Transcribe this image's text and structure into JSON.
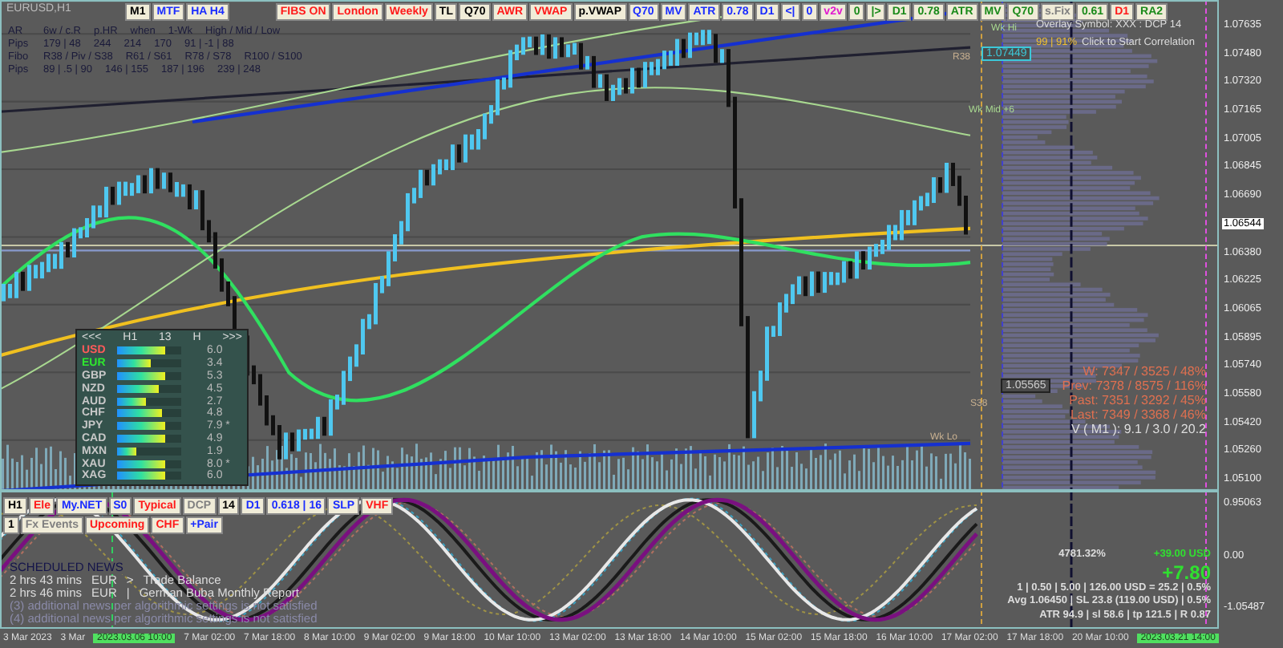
{
  "symbol": "EURUSD,H1",
  "toolbar": [
    {
      "label": "M1",
      "color": "#000000"
    },
    {
      "label": "MTF",
      "color": "#1a2cff"
    },
    {
      "label": "HA H4",
      "color": "#1a2cff"
    },
    {
      "label": "FIBS ON",
      "color": "#ff1a1a"
    },
    {
      "label": "London",
      "color": "#ff1a1a"
    },
    {
      "label": "Weekly",
      "color": "#ff1a1a"
    },
    {
      "label": "TL",
      "color": "#000000"
    },
    {
      "label": "Q70",
      "color": "#000000"
    },
    {
      "label": "AWR",
      "color": "#ff1a1a"
    },
    {
      "label": "VWAP",
      "color": "#ff1a1a"
    },
    {
      "label": "p.VWAP",
      "color": "#000000"
    },
    {
      "label": "Q70",
      "color": "#1a2cff"
    },
    {
      "label": "MV",
      "color": "#1a2cff"
    },
    {
      "label": "ATR",
      "color": "#1a2cff"
    },
    {
      "label": "0.78",
      "color": "#1a2cff"
    },
    {
      "label": "D1",
      "color": "#1a2cff"
    },
    {
      "label": "<|",
      "color": "#1a2cff"
    },
    {
      "label": "0",
      "color": "#1a2cff"
    },
    {
      "label": "v2v",
      "color": "#e01ad0"
    },
    {
      "label": "0",
      "color": "#1a8a1a"
    },
    {
      "label": "|>",
      "color": "#1a8a1a"
    },
    {
      "label": "D1",
      "color": "#1a8a1a"
    },
    {
      "label": "0.78",
      "color": "#1a8a1a"
    },
    {
      "label": "ATR",
      "color": "#1a8a1a"
    },
    {
      "label": "MV",
      "color": "#1a8a1a"
    },
    {
      "label": "Q70",
      "color": "#1a8a1a"
    },
    {
      "label": "s.Fix",
      "color": "#808080"
    },
    {
      "label": "0.61",
      "color": "#1a8a1a"
    },
    {
      "label": "D1",
      "color": "#ff1a1a"
    },
    {
      "label": "RA2",
      "color": "#1a8a1a"
    }
  ],
  "info_rows": [
    [
      "AR",
      "6w / c.R",
      "p.HR",
      "when",
      "1-Wk",
      "High / Mid / Low"
    ],
    [
      "Pips",
      "179 | 48",
      "244",
      "214",
      "170",
      "91 | -1 | 88"
    ],
    [
      "Fibo",
      "R38 / Piv / S38",
      "R61 / S61",
      "R78 / S78",
      "R100 / S100"
    ],
    [
      "Pips",
      "89 | .5 | 90",
      "146 | 155",
      "187 | 196",
      "239 | 248"
    ]
  ],
  "strength": {
    "header": [
      "<<<",
      "H1",
      "13",
      "H",
      ">>>"
    ],
    "rows": [
      {
        "currency": "USD",
        "value": "6.0",
        "level": 0.75,
        "color": "#ff5a5a"
      },
      {
        "currency": "EUR",
        "value": "3.4",
        "level": 0.52,
        "color": "#2ee82e"
      },
      {
        "currency": "GBP",
        "value": "5.3",
        "level": 0.75,
        "color": "#c8c8c8"
      },
      {
        "currency": "NZD",
        "value": "4.5",
        "level": 0.65,
        "color": "#c8c8c8"
      },
      {
        "currency": "AUD",
        "value": "2.7",
        "level": 0.45,
        "color": "#c8c8c8"
      },
      {
        "currency": "CHF",
        "value": "4.8",
        "level": 0.7,
        "color": "#c8c8c8"
      },
      {
        "currency": "JPY",
        "value": "7.9 *",
        "level": 0.75,
        "color": "#c8c8c8"
      },
      {
        "currency": "CAD",
        "value": "4.9",
        "level": 0.75,
        "color": "#c8c8c8"
      },
      {
        "currency": "MXN",
        "value": "1.9",
        "level": 0.3,
        "color": "#c8c8c8"
      },
      {
        "currency": "XAU",
        "value": "8.0 *",
        "level": 0.75,
        "color": "#c8c8c8"
      },
      {
        "currency": "XAG",
        "value": "6.0",
        "level": 0.75,
        "color": "#c8c8c8"
      }
    ]
  },
  "overlay": {
    "line1": "Overlay Symbol: XXX : DCP 14",
    "score": "99 | 91%",
    "action": "Click to Start Correlation"
  },
  "chart_labels": [
    {
      "text": "Wk Hi",
      "kind": "level"
    },
    {
      "text": "R38",
      "kind": "level"
    },
    {
      "text": "Wk Mid +6",
      "kind": "level"
    },
    {
      "text": "S38",
      "kind": "level"
    },
    {
      "text": "Wk Lo",
      "kind": "level"
    },
    {
      "text": "1.07449",
      "kind": "price"
    },
    {
      "text": "1.05565",
      "kind": "price"
    }
  ],
  "volume_stats": [
    "W: 7347 / 3525 / 48%",
    "Prev: 7378 / 8575 / 116%",
    "Past: 7351 / 3292 / 45%",
    "Last: 7349 / 3368 / 46%"
  ],
  "volume_m1": "V ( M1 ): 9.1 / 3.0 / 20.2",
  "price_axis": [
    {
      "text": "1.07635",
      "highlighted": false
    },
    {
      "text": "1.07480",
      "highlighted": false
    },
    {
      "text": "1.07320",
      "highlighted": false
    },
    {
      "text": "1.07165",
      "highlighted": false
    },
    {
      "text": "1.07005",
      "highlighted": false
    },
    {
      "text": "1.06845",
      "highlighted": false
    },
    {
      "text": "1.06690",
      "highlighted": false
    },
    {
      "text": "1.06544",
      "highlighted": true
    },
    {
      "text": "1.06380",
      "highlighted": false
    },
    {
      "text": "1.06225",
      "highlighted": false
    },
    {
      "text": "1.06065",
      "highlighted": false
    },
    {
      "text": "1.05895",
      "highlighted": false
    },
    {
      "text": "1.05740",
      "highlighted": false
    },
    {
      "text": "1.05580",
      "highlighted": false
    },
    {
      "text": "1.05420",
      "highlighted": false
    },
    {
      "text": "1.05260",
      "highlighted": false
    },
    {
      "text": "1.05100",
      "highlighted": false
    }
  ],
  "osc_toolbar": [
    [
      {
        "label": "H1",
        "color": "#000000"
      },
      {
        "label": "Ele",
        "color": "#ff1a1a"
      },
      {
        "label": "My.NET",
        "color": "#1a2cff"
      },
      {
        "label": "S0",
        "color": "#1a2cff"
      },
      {
        "label": "Typical",
        "color": "#ff1a1a"
      },
      {
        "label": "DCP",
        "color": "#808080"
      },
      {
        "label": "14",
        "color": "#000000"
      },
      {
        "label": "D1",
        "color": "#1a2cff"
      },
      {
        "label": "0.618 | 16",
        "color": "#1a2cff"
      },
      {
        "label": "SLP",
        "color": "#1a2cff"
      },
      {
        "label": "VHF",
        "color": "#ff1a1a"
      }
    ],
    [
      {
        "label": "1",
        "color": "#000000"
      },
      {
        "label": "Fx Events",
        "color": "#808080"
      },
      {
        "label": "Upcoming",
        "color": "#ff1a1a"
      },
      {
        "label": "CHF",
        "color": "#ff1a1a"
      },
      {
        "label": "+Pair",
        "color": "#1a2cff"
      }
    ]
  ],
  "news": {
    "title": "SCHEDULED NEWS",
    "items": [
      {
        "time": "2 hrs 43 mins",
        "currency": "EUR",
        "sep": ">",
        "event": "Trade Balance"
      },
      {
        "time": "2 hrs 46 mins",
        "currency": "EUR",
        "sep": "|",
        "event": "German Buba Monthly Report"
      }
    ],
    "notes": [
      "(3) additional news per algorithmic settings is not satisfied",
      "(4) additional news per algorithmic settings is not satisfied"
    ]
  },
  "trade": {
    "percent": "4781.32%",
    "profit": "+39.00 USD",
    "pips": "+7.80",
    "lines": [
      "1 | 0.50 | 5.00 | 126.00 USD = 25.2 | 0.5%",
      "Avg 1.06450 | SL 23.8 (119.00 USD) | 0.5%",
      "ATR 94.9 | sl 58.6 | tp 121.5 | R 0.87"
    ]
  },
  "osc_axis": [
    "0.95063",
    "0.00",
    "-1.05487"
  ],
  "time_axis": [
    {
      "text": "3 Mar 2023",
      "highlighted": false
    },
    {
      "text": "3 Mar",
      "highlighted": false
    },
    {
      "text": "2023.03.06 10:00",
      "highlighted": true
    },
    {
      "text": "7 Mar 02:00",
      "highlighted": false
    },
    {
      "text": "7 Mar 18:00",
      "highlighted": false
    },
    {
      "text": "8 Mar 10:00",
      "highlighted": false
    },
    {
      "text": "9 Mar 02:00",
      "highlighted": false
    },
    {
      "text": "9 Mar 18:00",
      "highlighted": false
    },
    {
      "text": "10 Mar 10:00",
      "highlighted": false
    },
    {
      "text": "13 Mar 02:00",
      "highlighted": false
    },
    {
      "text": "13 Mar 18:00",
      "highlighted": false
    },
    {
      "text": "14 Mar 10:00",
      "highlighted": false
    },
    {
      "text": "15 Mar 02:00",
      "highlighted": false
    },
    {
      "text": "15 Mar 18:00",
      "highlighted": false
    },
    {
      "text": "16 Mar 10:00",
      "highlighted": false
    },
    {
      "text": "17 Mar 02:00",
      "highlighted": false
    },
    {
      "text": "17 Mar 18:00",
      "highlighted": false
    },
    {
      "text": "20 Mar 10:00",
      "highlighted": false
    },
    {
      "text": "2023.03.21 14:00",
      "highlighted": true
    }
  ]
}
